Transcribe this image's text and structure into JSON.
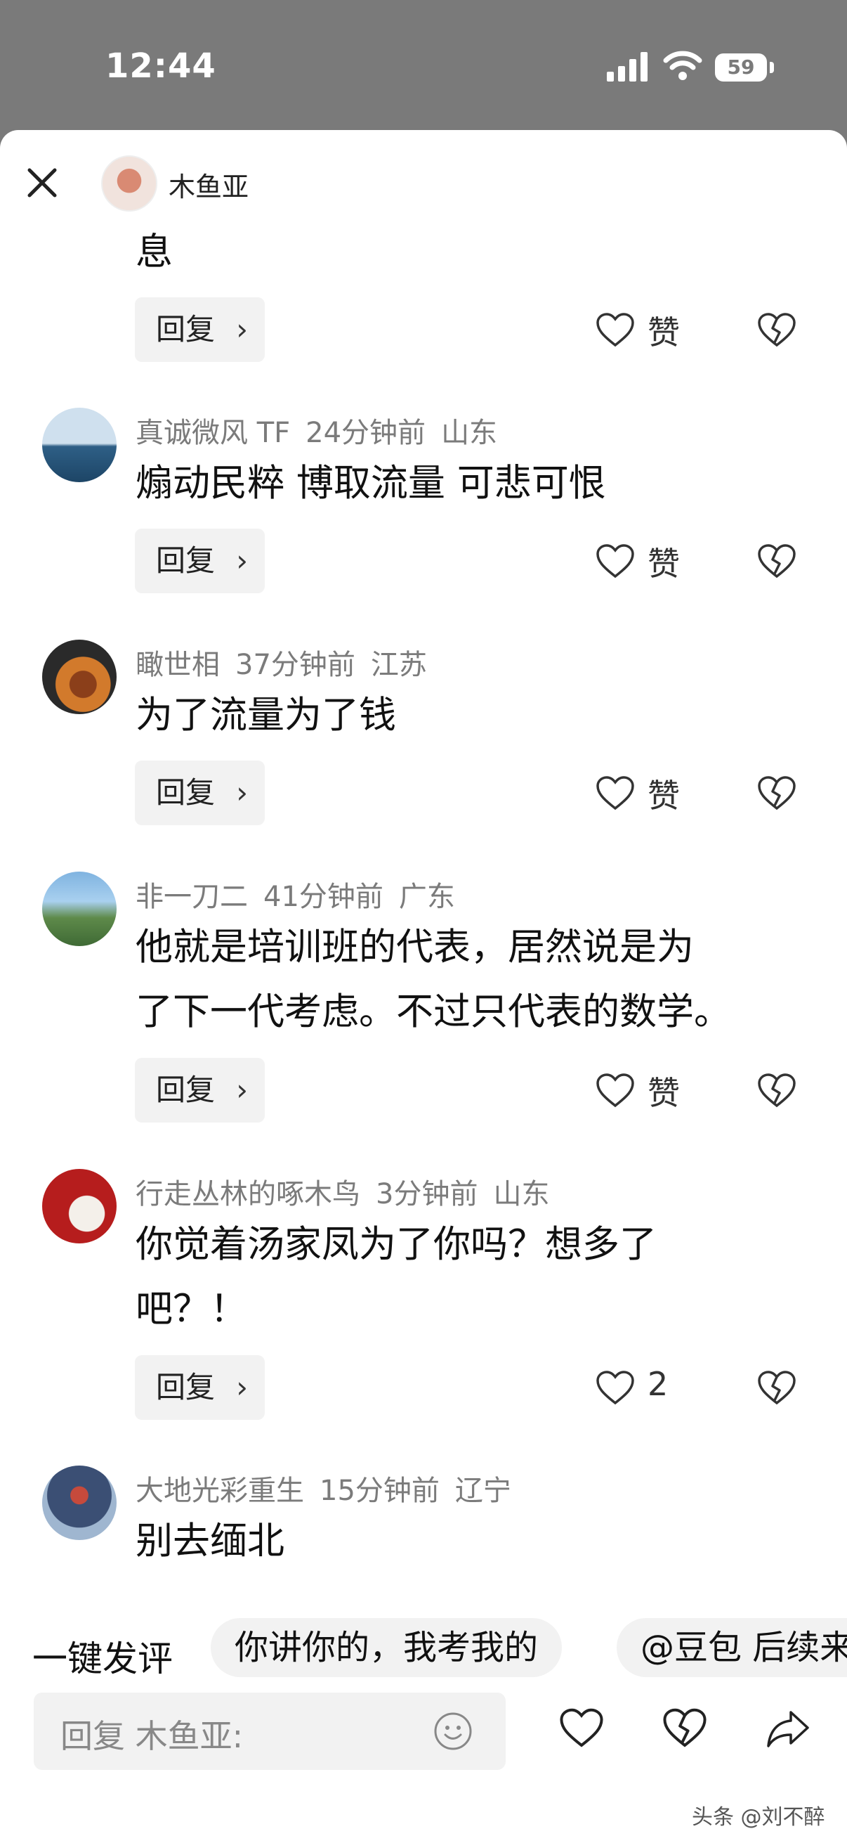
{
  "status": {
    "time": "12:44",
    "battery": "59"
  },
  "header": {
    "author": "木鱼亚"
  },
  "partial_comment": {
    "text": "息",
    "reply_label": "回复",
    "like_label": "赞"
  },
  "comments": [
    {
      "user": "真诚微风 TF",
      "time": "24分钟前",
      "region": "山东",
      "text_lines": [
        "煽动民粹 博取流量 可悲可恨"
      ],
      "reply_label": "回复",
      "like_label": "赞"
    },
    {
      "user": "瞰世相",
      "time": "37分钟前",
      "region": "江苏",
      "text_lines": [
        "为了流量为了钱"
      ],
      "reply_label": "回复",
      "like_label": "赞"
    },
    {
      "user": "非一刀二",
      "time": "41分钟前",
      "region": "广东",
      "text_lines": [
        "他就是培训班的代表，居然说是为",
        "了下一代考虑。不过只代表的数学。"
      ],
      "reply_label": "回复",
      "like_label": "赞"
    },
    {
      "user": "行走丛林的啄木鸟",
      "time": "3分钟前",
      "region": "山东",
      "text_lines": [
        "你觉着汤家凤为了你吗？想多了",
        "吧？！"
      ],
      "reply_label": "回复",
      "like_label": "2"
    },
    {
      "user": "大地光彩重生",
      "time": "15分钟前",
      "region": "辽宁",
      "text_lines": [
        "别去缅北"
      ]
    }
  ],
  "quick": {
    "label": "一键发评",
    "chips": [
      "你讲你的，我考我的",
      "@豆包 后续来"
    ]
  },
  "input": {
    "placeholder": "回复 木鱼亚:"
  },
  "watermark": "头条 @刘不醉"
}
